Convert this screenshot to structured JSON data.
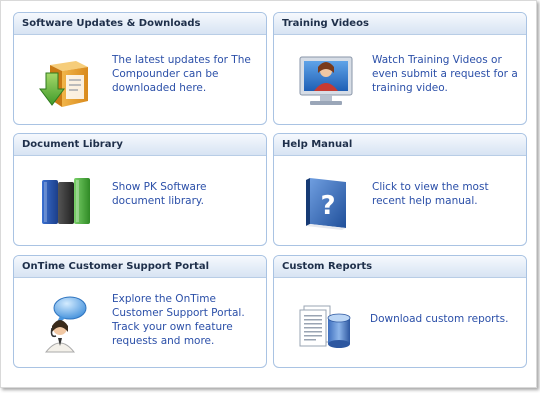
{
  "panels": [
    {
      "title": "Software Updates & Downloads",
      "description": "The latest updates for The Compounder can be downloaded here.",
      "icon": "download-box-icon"
    },
    {
      "title": "Training Videos",
      "description": "Watch Training Videos or even submit a request for a training video.",
      "icon": "training-video-monitor-icon"
    },
    {
      "title": "Document Library",
      "description": "Show PK Software document library.",
      "icon": "books-icon"
    },
    {
      "title": "Help Manual",
      "description": "Click to view the most recent help manual.",
      "icon": "help-book-icon"
    },
    {
      "title": "OnTime Customer Support Portal",
      "description": "Explore the OnTime Customer Support Portal. Track your own feature requests and more.",
      "icon": "support-person-chat-icon"
    },
    {
      "title": "Custom Reports",
      "description": "Download custom reports.",
      "icon": "report-database-icon"
    }
  ],
  "colors": {
    "panel_border": "#a9c3e3",
    "header_text": "#1e2f4a",
    "description_text": "#2b4fa8"
  }
}
